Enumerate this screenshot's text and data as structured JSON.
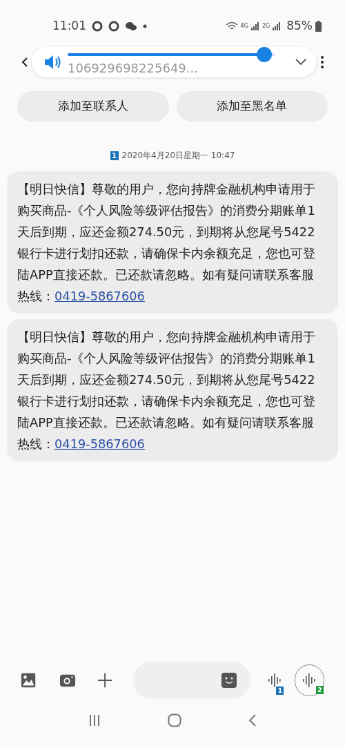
{
  "status_bar": {
    "time": "11:01",
    "network_1": "4G",
    "network_2": "2G",
    "battery": "85%"
  },
  "header": {
    "number": "106929698225649...",
    "volume": {
      "level": 0.95
    }
  },
  "actions": [
    "添加至联系人",
    "添加至黑名单"
  ],
  "date": {
    "sim": "1",
    "text": "2020年4月20日星期一 10:47"
  },
  "messages": [
    {
      "text": "【明日快信】尊敬的用户，您向持牌金融机构申请用于购买商品-《个人风险等级评估报告》的消费分期账单1天后到期，应还金额274.50元，到期将从您尾号5422银行卡进行划扣还款，请确保卡内余额充足，您也可登陆APP直接还款。已还款请忽略。如有疑问请联系客服热线：",
      "link": "0419-5867606"
    },
    {
      "text": "【明日快信】尊敬的用户，您向持牌金融机构申请用于购买商品-《个人风险等级评估报告》的消费分期账单1天后到期，应还金额274.50元，到期将从您尾号5422银行卡进行划扣还款，请确保卡内余额充足，您也可登陆APP直接还款。已还款请忽略。如有疑问请联系客服热线：",
      "link": "0419-5867606"
    }
  ],
  "composer": {
    "voice_sims": [
      {
        "sim": "1",
        "color": "#1a73b5"
      },
      {
        "sim": "2",
        "color": "#1e9a3c"
      }
    ]
  }
}
